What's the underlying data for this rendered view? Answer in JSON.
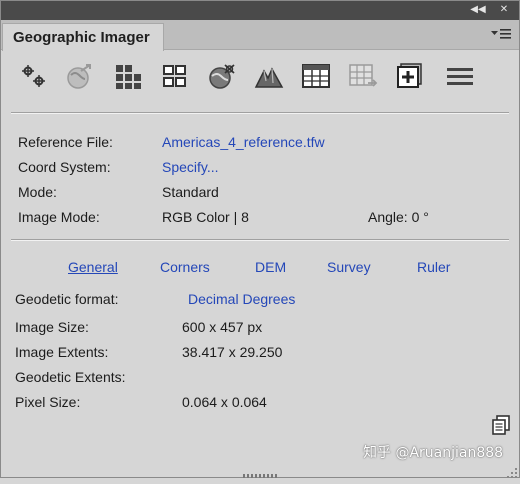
{
  "panel": {
    "title": "Geographic Imager"
  },
  "toolbar": {
    "tools": [
      {
        "icon": "georeference-points-icon"
      },
      {
        "icon": "reproject-globe-icon"
      },
      {
        "icon": "tiling-grid-icon"
      },
      {
        "icon": "mosaic-grid-icon"
      },
      {
        "icon": "globe-transform-icon"
      },
      {
        "icon": "terrain-shading-icon"
      },
      {
        "icon": "attribute-table-icon"
      },
      {
        "icon": "export-table-icon"
      },
      {
        "icon": "add-layer-icon"
      },
      {
        "icon": "menu-lines-icon"
      }
    ]
  },
  "reference": {
    "file_label": "Reference File:",
    "file_value": "Americas_4_reference.tfw",
    "coord_label": "Coord System:",
    "coord_value": "Specify...",
    "mode_label": "Mode:",
    "mode_value": "Standard",
    "image_mode_label": "Image Mode:",
    "image_mode_value": "RGB Color | 8",
    "angle_label": "Angle: 0 °"
  },
  "tabs": [
    {
      "label": "General",
      "active": true
    },
    {
      "label": "Corners",
      "active": false
    },
    {
      "label": "DEM",
      "active": false
    },
    {
      "label": "Survey",
      "active": false
    },
    {
      "label": "Ruler",
      "active": false
    }
  ],
  "general": {
    "geodetic_format_label": "Geodetic format:",
    "geodetic_format_value": "Decimal Degrees",
    "image_size_label": "Image Size:",
    "image_size_value": "600 x 457 px",
    "image_extents_label": "Image Extents:",
    "image_extents_value": "38.417 x 29.250",
    "geodetic_extents_label": "Geodetic Extents:",
    "pixel_size_label": "Pixel Size:",
    "pixel_size_value": "0.064 x 0.064"
  },
  "watermark": "知乎 @Aruanjian888",
  "colors": {
    "link": "#2447b8",
    "panel_bg": "#d6d6d6",
    "topbar": "#4a4a4a"
  }
}
